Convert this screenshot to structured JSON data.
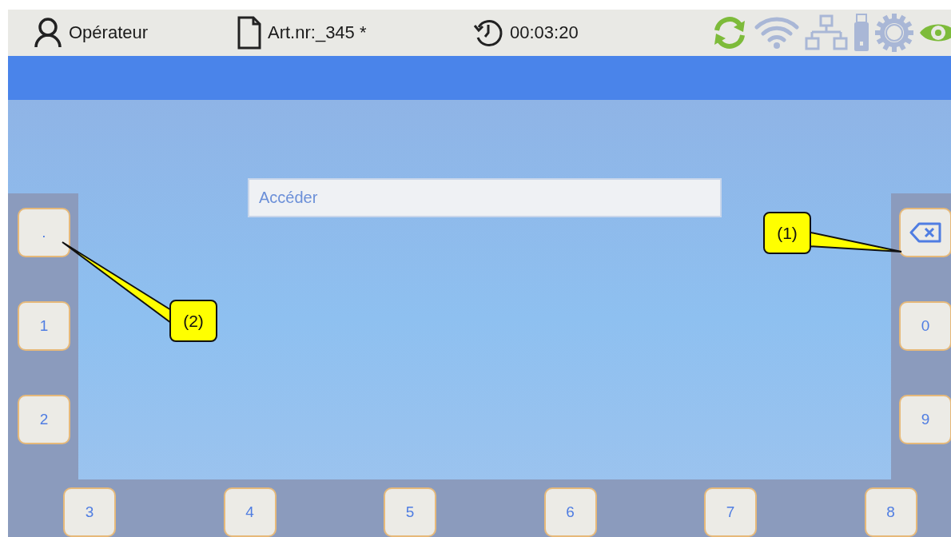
{
  "status_bar": {
    "user": "Opérateur",
    "article": "Art.nr:_345 *",
    "timer": "00:03:20",
    "indicators": [
      {
        "kind": "sync",
        "active": true
      },
      {
        "kind": "wifi",
        "active": false
      },
      {
        "kind": "network",
        "active": false
      },
      {
        "kind": "usb",
        "active": false
      },
      {
        "kind": "settings",
        "active": false
      },
      {
        "kind": "view",
        "active": true
      }
    ]
  },
  "input": {
    "placeholder": "Accéder"
  },
  "left_keys": [
    {
      "kind": "char",
      "label": "."
    },
    {
      "kind": "char",
      "label": "1"
    },
    {
      "kind": "char",
      "label": "2"
    }
  ],
  "right_keys": [
    {
      "kind": "backspace"
    },
    {
      "kind": "char",
      "label": "0"
    },
    {
      "kind": "char",
      "label": "9"
    }
  ],
  "bottom_keys": [
    {
      "kind": "char",
      "label": "3"
    },
    {
      "kind": "char",
      "label": "4"
    },
    {
      "kind": "char",
      "label": "5"
    },
    {
      "kind": "char",
      "label": "6"
    },
    {
      "kind": "char",
      "label": "7"
    },
    {
      "kind": "char",
      "label": "8"
    }
  ],
  "callouts": [
    {
      "label": "(1)",
      "kind": "right"
    },
    {
      "label": "(2)",
      "kind": "left"
    }
  ]
}
